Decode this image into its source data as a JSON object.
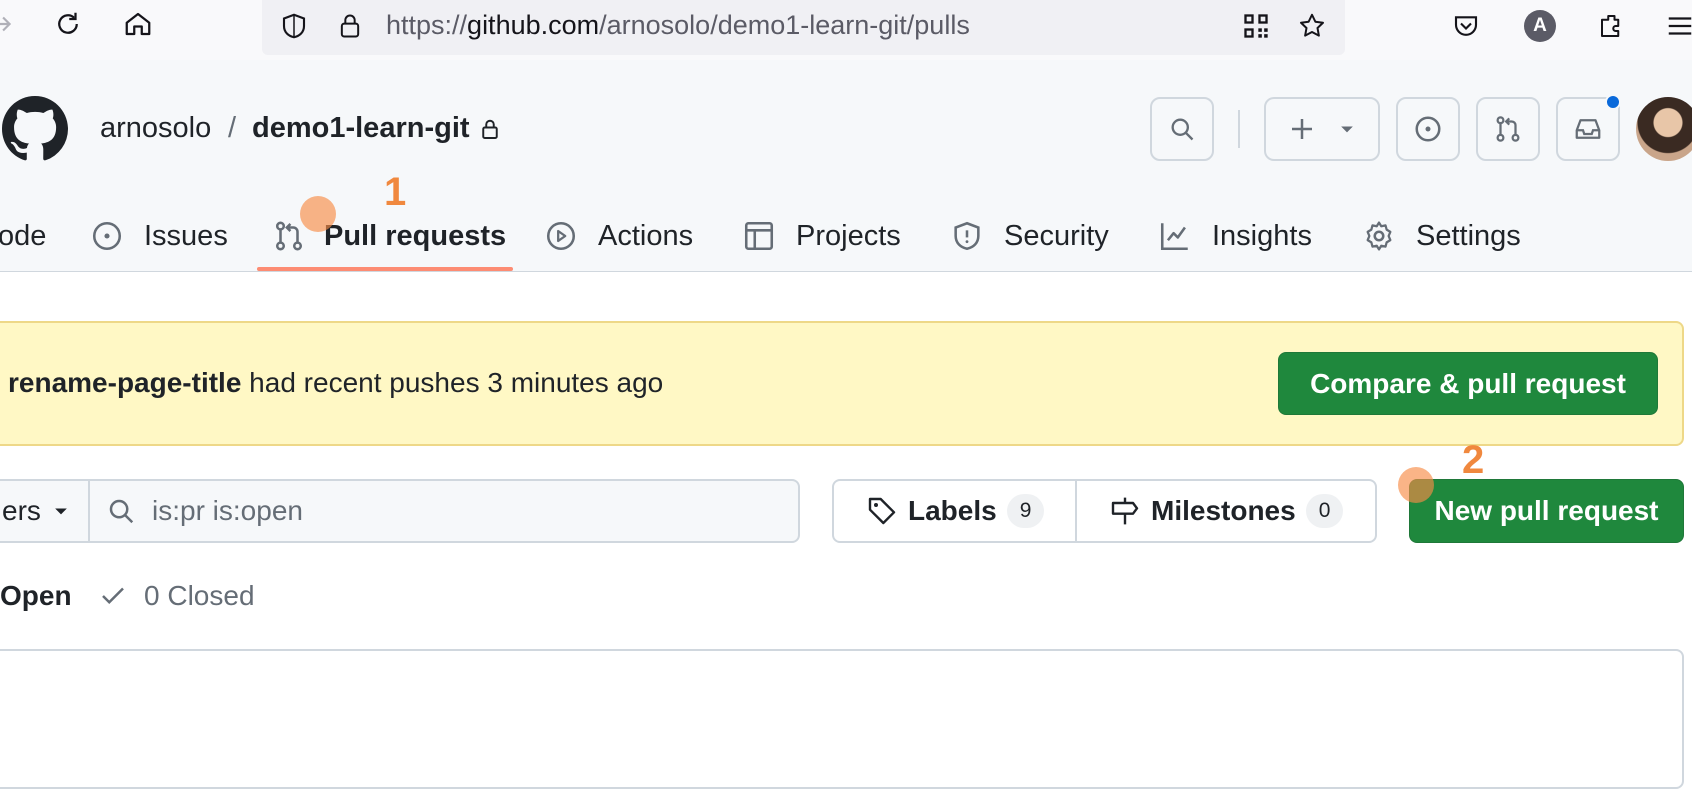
{
  "browser": {
    "url_prefix": "https://",
    "url_domain": "github.com",
    "url_path": "/arnosolo/demo1-learn-git/pulls",
    "account_initial": "A"
  },
  "repo": {
    "owner": "arnosolo",
    "separator": "/",
    "name": "demo1-learn-git"
  },
  "tabs": [
    {
      "label": "Code",
      "visible_label": "ode",
      "icon": "code-icon"
    },
    {
      "label": "Issues",
      "icon": "issue-opened-icon"
    },
    {
      "label": "Pull requests",
      "icon": "git-pull-request-icon",
      "active": true
    },
    {
      "label": "Actions",
      "icon": "play-icon"
    },
    {
      "label": "Projects",
      "icon": "table-icon"
    },
    {
      "label": "Security",
      "icon": "shield-icon"
    },
    {
      "label": "Insights",
      "icon": "graph-icon"
    },
    {
      "label": "Settings",
      "icon": "gear-icon"
    }
  ],
  "annotations": {
    "marker1": "1",
    "marker2": "2"
  },
  "flash": {
    "branch": "rename-page-title",
    "message": " had recent pushes 3 minutes ago",
    "button": "Compare & pull request"
  },
  "filters": {
    "filter_label": "ers",
    "search_value": "is:pr is:open",
    "labels_label": "Labels",
    "labels_count": "9",
    "milestones_label": "Milestones",
    "milestones_count": "0",
    "new_pr_button": "New pull request"
  },
  "states": {
    "open_label": "Open",
    "closed_label": "0 Closed"
  },
  "colors": {
    "accent_green": "#1f883d",
    "tab_underline": "#fd8c73",
    "flash_bg": "#fff8c5",
    "annotation": "#f0883e"
  }
}
